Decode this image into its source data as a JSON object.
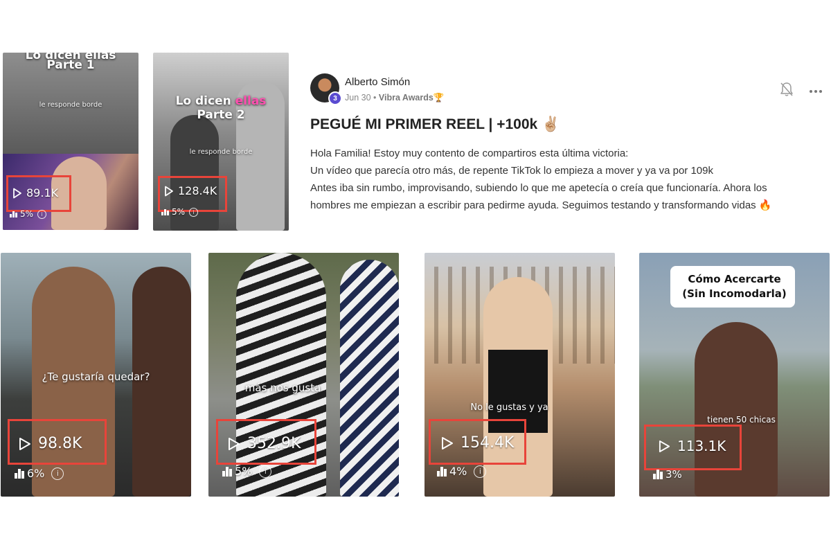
{
  "top_thumbs": [
    {
      "line1": "Lo dicen ellas",
      "line2": "Parte 1",
      "caption": "le responde borde",
      "views": "89.1K",
      "stat": "5%"
    },
    {
      "line1": "Lo dicen",
      "line1_accent": "ellas",
      "line2": "Parte 2",
      "caption": "le responde borde",
      "views": "128.4K",
      "stat": "5%"
    }
  ],
  "post": {
    "author": "Alberto Simón",
    "level": "3",
    "date": "Jun 30",
    "separator": " • ",
    "group": "Vibra Awards🏆",
    "title": "PEGUÉ MI PRIMER REEL | +100k ✌🏼",
    "body": [
      "Hola Familia! Estoy muy contento de compartiros esta última victoria:",
      "Un vídeo que parecía otro más, de repente TikTok lo empieza a mover y ya va por 109k",
      "Antes iba sin rumbo, improvisando, subiendo lo que me apetecía o creía que funcionaría. Ahora los",
      "hombres me empiezan a escribir para pedirme ayuda. Seguimos testando y transformando vidas 🔥"
    ]
  },
  "bottom_thumbs": [
    {
      "caption": "¿Te gustaría quedar?",
      "views": "98.8K",
      "stat": "6%"
    },
    {
      "caption": "más nos gusta",
      "views": "352.9K",
      "stat": "5%"
    },
    {
      "caption": "No le gustas y ya",
      "views": "154.4K",
      "stat": "4%"
    },
    {
      "title1": "Cómo Acercarte",
      "title2": "(Sin Incomodarla)",
      "caption": "tienen 50 chicas",
      "views": "113.1K",
      "stat": "3%"
    }
  ],
  "icons": {
    "bell": "bell-icon",
    "more": "more-options-icon",
    "play": "play-icon",
    "stats": "bar-chart-icon",
    "info": "info-icon"
  },
  "colors": {
    "highlight_box": "#e8443a",
    "accent_pink": "#ff4fb0",
    "level_badge": "#5a4bd1"
  }
}
